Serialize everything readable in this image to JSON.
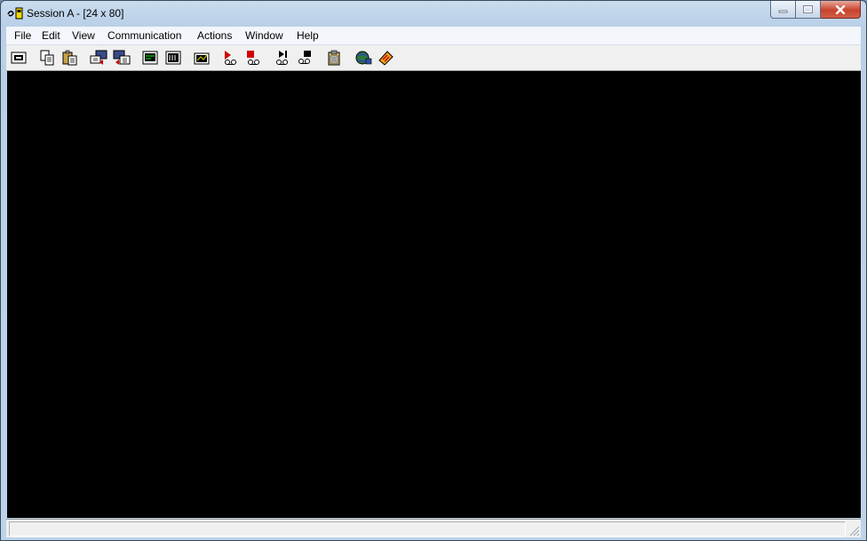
{
  "window": {
    "title": "Session A - [24 x 80]"
  },
  "menu": [
    "File",
    "Edit",
    "View",
    "Communication",
    "Actions",
    "Window",
    "Help"
  ],
  "toolbar": {
    "buttons": [
      {
        "icon": "print-screen-icon"
      },
      {
        "icon": "copy-icon"
      },
      {
        "icon": "paste-icon"
      },
      {
        "icon": "send-file-to-host-icon"
      },
      {
        "icon": "receive-file-from-host-icon"
      },
      {
        "icon": "display-setup-icon"
      },
      {
        "icon": "customize-keyboard-icon"
      },
      {
        "icon": "color-map-icon"
      },
      {
        "icon": "record-macro-icon"
      },
      {
        "icon": "stop-macro-icon"
      },
      {
        "icon": "play-macro-icon"
      },
      {
        "icon": "macro-setup-icon"
      },
      {
        "icon": "clipboard-icon"
      },
      {
        "icon": "connection-status-icon"
      },
      {
        "icon": "support-icon"
      }
    ]
  },
  "status_bar": {
    "text": ""
  },
  "colors": {
    "terminal_background": "#000000",
    "chrome": "#bcd3ea"
  }
}
